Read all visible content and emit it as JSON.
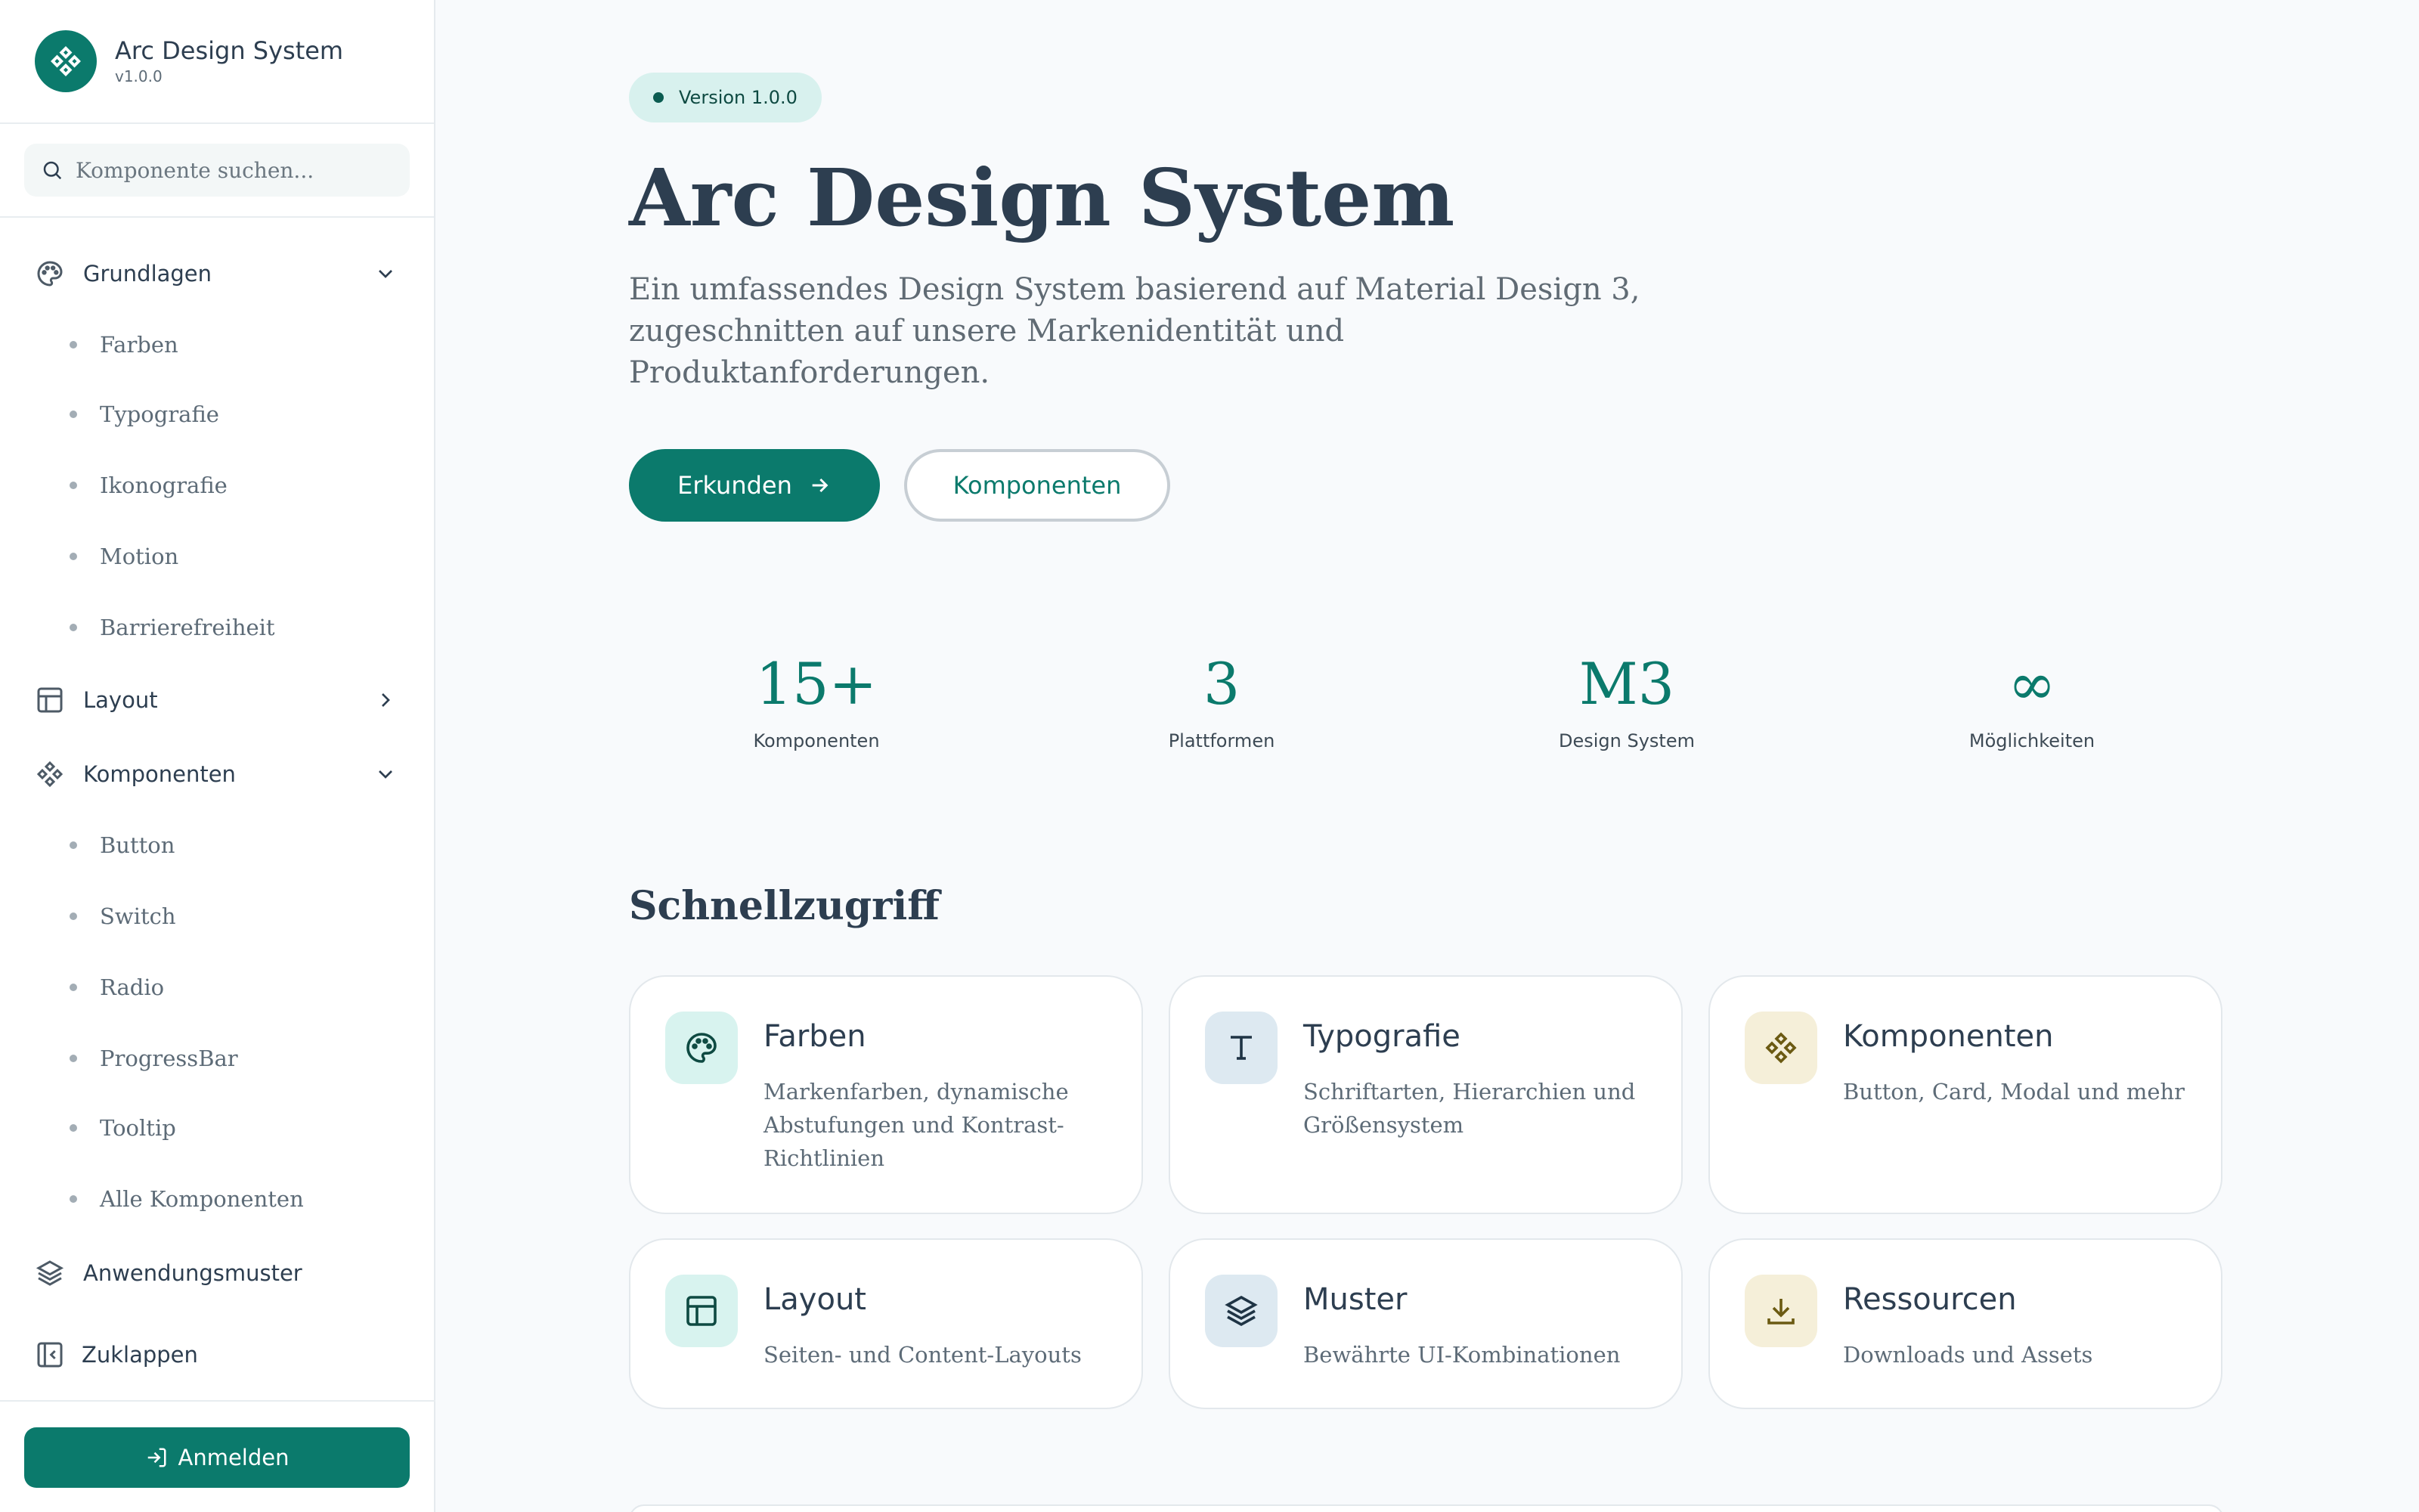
{
  "brand": {
    "title": "Arc Design System",
    "version": "v1.0.0"
  },
  "search": {
    "placeholder": "Komponente suchen..."
  },
  "nav": {
    "grundlagen": {
      "label": "Grundlagen",
      "items": [
        "Farben",
        "Typografie",
        "Ikonografie",
        "Motion",
        "Barrierefreiheit"
      ]
    },
    "layout": {
      "label": "Layout"
    },
    "komponenten": {
      "label": "Komponenten",
      "items": [
        "Button",
        "Switch",
        "Radio",
        "ProgressBar",
        "Tooltip",
        "Alle Komponenten"
      ]
    },
    "anwendungsmuster": {
      "label": "Anwendungsmuster"
    },
    "collapse_label": "Zuklappen",
    "login_label": "Anmelden"
  },
  "hero": {
    "version_badge": "Version 1.0.0",
    "title": "Arc Design System",
    "subtitle": "Ein umfassendes Design System basierend auf Material Design 3, zugeschnitten auf unsere Markenidentität und Produktanforderungen.",
    "primary_button": "Erkunden",
    "secondary_button": "Komponenten"
  },
  "stats": [
    {
      "value": "15+",
      "label": "Komponenten"
    },
    {
      "value": "3",
      "label": "Plattformen"
    },
    {
      "value": "M3",
      "label": "Design System"
    },
    {
      "value": "∞",
      "label": "Möglichkeiten"
    }
  ],
  "quick_access": {
    "title": "Schnellzugriff",
    "cards": [
      {
        "title": "Farben",
        "desc": "Markenfarben, dynamische Abstufungen und Kontrast-Richtlinien",
        "icon": "palette-icon"
      },
      {
        "title": "Typografie",
        "desc": "Schriftarten, Hierarchien und Größensystem",
        "icon": "type-icon"
      },
      {
        "title": "Komponenten",
        "desc": "Button, Card, Modal und mehr",
        "icon": "components-icon"
      },
      {
        "title": "Layout",
        "desc": "Seiten- und Content-Layouts",
        "icon": "layout-icon"
      },
      {
        "title": "Muster",
        "desc": "Bewährte UI-Kombinationen",
        "icon": "layers-icon"
      },
      {
        "title": "Ressourcen",
        "desc": "Downloads und Assets",
        "icon": "download-icon"
      }
    ]
  },
  "colors": {
    "accent": "#0b7a6c",
    "text": "#2d3e50",
    "muted": "#5d6b77",
    "background": "#f8fafc"
  }
}
